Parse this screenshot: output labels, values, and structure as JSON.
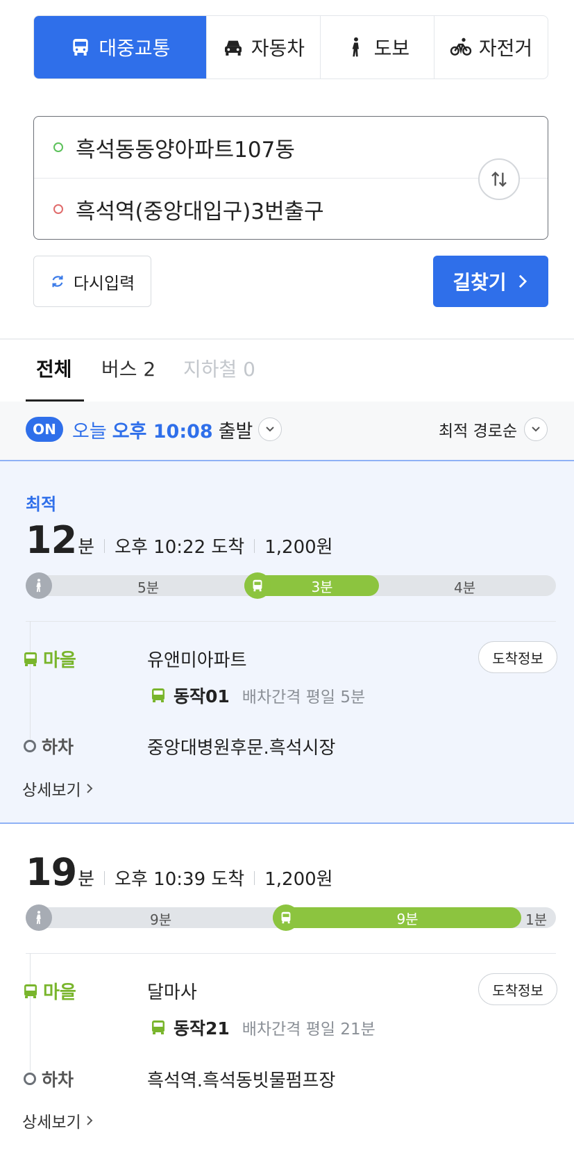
{
  "modes": [
    {
      "label": "대중교통",
      "icon": "bus-icon"
    },
    {
      "label": "자동차",
      "icon": "car-icon"
    },
    {
      "label": "도보",
      "icon": "walk-icon"
    },
    {
      "label": "자전거",
      "icon": "bicycle-icon"
    }
  ],
  "route": {
    "origin": "흑석동동양아파트107동",
    "destination": "흑석역(중앙대입구)3번출구"
  },
  "buttons": {
    "reset": "다시입력",
    "search": "길찾기"
  },
  "result_tabs": [
    "전체",
    "버스 2",
    "지하철 0"
  ],
  "filter": {
    "on_badge": "ON",
    "day": "오늘",
    "time": "오후 10:08",
    "suffix": "출발",
    "sort": "최적 경로순"
  },
  "routes": [
    {
      "tag": "최적",
      "minutes": "12",
      "unit": "분",
      "arrival": "오후 10:22 도착",
      "fare": "1,200원",
      "segments": [
        "5분",
        "3분",
        "4분"
      ],
      "bus_type": "마을",
      "board_stop": "유앤미아파트",
      "arrive_button": "도착정보",
      "bus_no": "동작01",
      "interval": "배차간격 평일 5분",
      "off_label": "하차",
      "off_stop": "중앙대병원후문.흑석시장",
      "detail": "상세보기"
    },
    {
      "minutes": "19",
      "unit": "분",
      "arrival": "오후 10:39 도착",
      "fare": "1,200원",
      "segments": [
        "9분",
        "9분",
        "1분"
      ],
      "bus_type": "마을",
      "board_stop": "달마사",
      "arrive_button": "도착정보",
      "bus_no": "동작21",
      "interval": "배차간격 평일 21분",
      "off_label": "하차",
      "off_stop": "흑석역.흑석동빗물펌프장",
      "detail": "상세보기"
    }
  ],
  "colors": {
    "accent": "#2f6fea",
    "bus_green": "#8cc43f",
    "origin_dot": "#5cc15a",
    "dest_dot": "#e06b6b"
  }
}
